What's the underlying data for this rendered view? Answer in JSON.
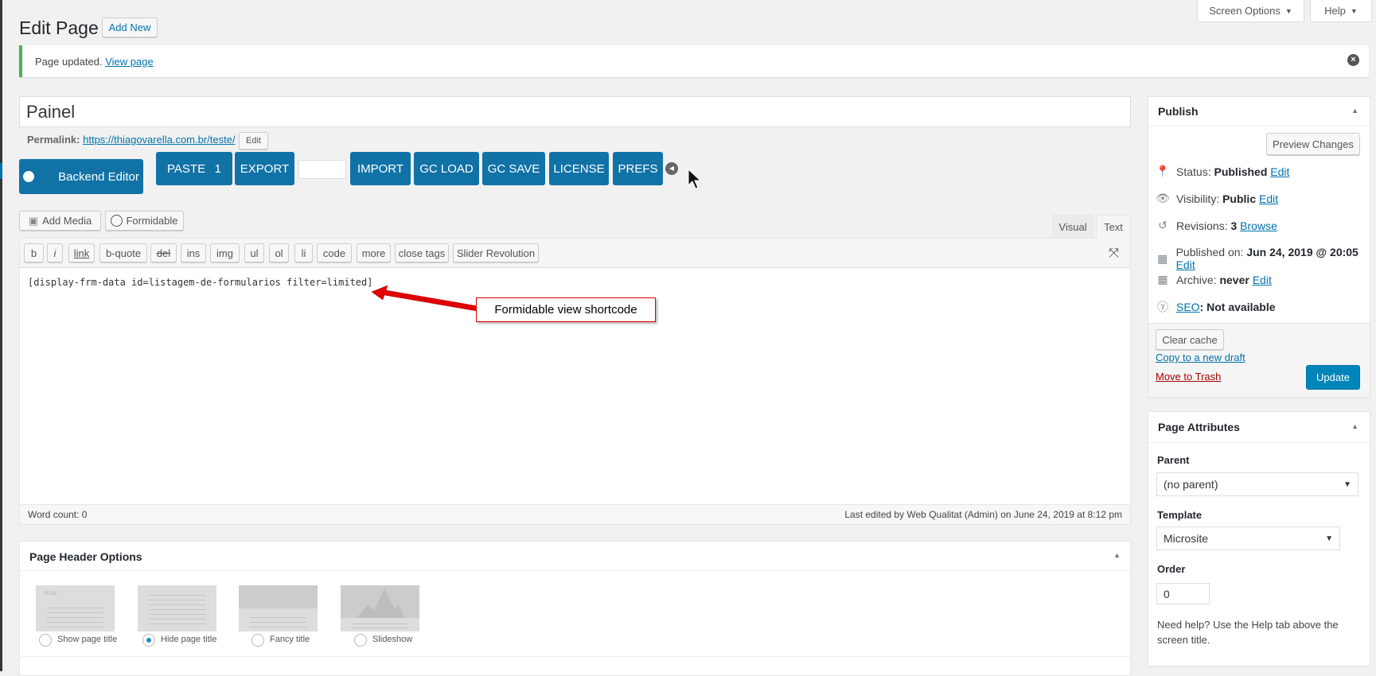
{
  "header": {
    "title": "Edit Page",
    "add_new": "Add New",
    "screen_options": "Screen Options",
    "help": "Help"
  },
  "notice": {
    "text": "Page updated.",
    "link": "View page"
  },
  "post": {
    "title": "Painel",
    "permalink_label": "Permalink:",
    "permalink_url": "https://thiagovarella.com.br/teste/",
    "permalink_edit": "Edit"
  },
  "plugin_toolbar": {
    "backend_editor": "Backend Editor",
    "paste": "PASTE",
    "paste_count": "1",
    "export": "EXPORT",
    "export_input": "",
    "import": "IMPORT",
    "gc_load": "GC LOAD",
    "gc_save": "GC SAVE",
    "license": "LICENSE",
    "prefs": "PREFS",
    "accent": "#1172a6"
  },
  "media": {
    "add_media": "Add Media",
    "formidable": "Formidable"
  },
  "editor": {
    "tabs": [
      {
        "label": "Visual"
      },
      {
        "label": "Text",
        "active": true
      }
    ],
    "quicktags": [
      "b",
      "i",
      "link",
      "b-quote",
      "del",
      "ins",
      "img",
      "ul",
      "ol",
      "li",
      "code",
      "more",
      "close tags",
      "Slider Revolution"
    ],
    "content": "[display-frm-data id=listagem-de-formularios filter=limited]",
    "word_count": "Word count: 0",
    "last_edited": "Last edited by Web Qualitat (Admin) on June 24, 2019 at 8:12 pm"
  },
  "annotation": {
    "text": "Formidable view shortcode",
    "color": "#e00000"
  },
  "page_header_options": {
    "title": "Page Header Options",
    "options": [
      {
        "label": "Show page title",
        "selected": false
      },
      {
        "label": "Hide page title",
        "selected": true
      },
      {
        "label": "Fancy title",
        "selected": false
      },
      {
        "label": "Slideshow",
        "selected": false
      }
    ],
    "thumb_text": "TITLE"
  },
  "publish": {
    "title": "Publish",
    "preview": "Preview Changes",
    "status_label": "Status:",
    "status": "Published",
    "visibility_label": "Visibility:",
    "visibility": "Public",
    "revisions_label": "Revisions:",
    "revisions": "3",
    "browse": "Browse",
    "published_label": "Published on:",
    "published": "Jun 24, 2019 @ 20:05",
    "archive_label": "Archive:",
    "archive": "never",
    "edit": "Edit",
    "seo": "SEO",
    "seo_value": ": Not available",
    "clear_cache": "Clear cache",
    "copy_draft": "Copy to a new draft",
    "trash": "Move to Trash",
    "update": "Update"
  },
  "attributes": {
    "title": "Page Attributes",
    "parent_label": "Parent",
    "parent": "(no parent)",
    "template_label": "Template",
    "template": "Microsite",
    "order_label": "Order",
    "order": "0",
    "help": "Need help? Use the Help tab above the screen title."
  }
}
